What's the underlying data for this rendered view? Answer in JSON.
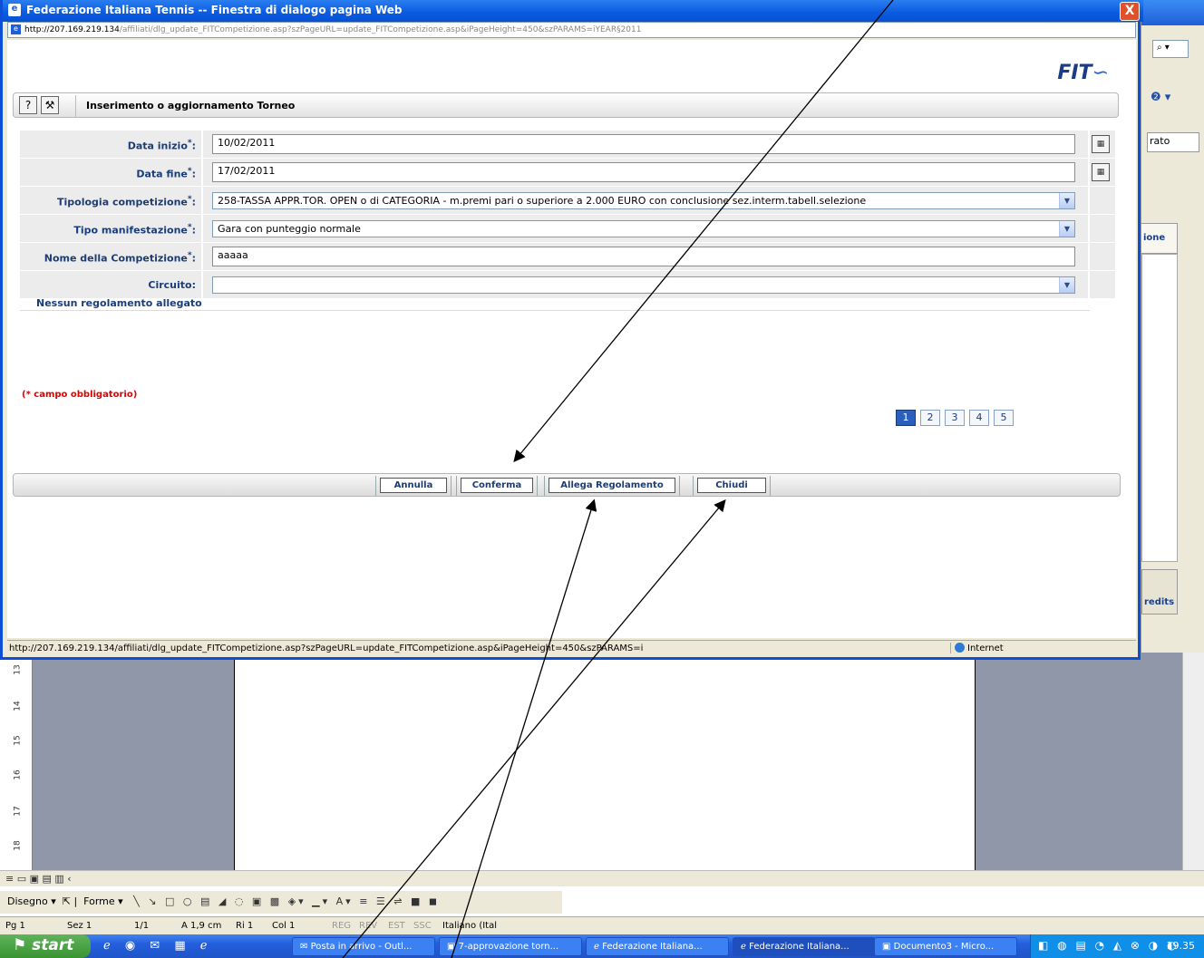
{
  "dialog": {
    "title": "Federazione Italiana Tennis -- Finestra di dialogo pagina Web",
    "close_label": "X",
    "url_host": "http://207.169.219.134",
    "url_path": "/affiliati/dlg_update_FITCompetizione.asp?szPageURL=update_FITCompetizione.asp&iPageHeight=450&szPARAMS=iYEAR§2011",
    "logo_text": "FIT",
    "status_url": "http://207.169.219.134/affiliati/dlg_update_FITCompetizione.asp?szPageURL=update_FITCompetizione.asp&iPageHeight=450&szPARAMS=i",
    "zone": "Internet"
  },
  "header": {
    "help_icon": "?",
    "tool_icon": "⚒",
    "title": "Inserimento o aggiornamento Torneo"
  },
  "form": {
    "data_inizio_label": "Data inizio",
    "data_inizio_value": "10/02/2011",
    "data_fine_label": "Data fine",
    "data_fine_value": "17/02/2011",
    "tipologia_label": "Tipologia competizione",
    "tipologia_value": "258-TASSA APPR.TOR. OPEN o di CATEGORIA - m.premi pari o superiore a 2.000 EURO con conclusione sez.interm.tabell.selezione",
    "tipo_label": "Tipo manifestazione",
    "tipo_value": "Gara con punteggio normale",
    "nome_label": "Nome della Competizione",
    "nome_value": "aaaaa",
    "circuito_label": "Circuito",
    "circuito_value": "",
    "required_mark": "*",
    "colon": ":",
    "no_regolamento": "Nessun regolamento allegato",
    "required_note": "(* campo obbligatorio)"
  },
  "pager": [
    "1",
    "2",
    "3",
    "4",
    "5"
  ],
  "buttons": {
    "annulla": "Annulla",
    "conferma": "Conferma",
    "allega": "Allega Regolamento",
    "chiudi": "Chiudi"
  },
  "background": {
    "right_text": "rato",
    "right_tab": "ione",
    "right_btn": "redits",
    "ruler_marks": [
      "13",
      "14",
      "15",
      "16",
      "17",
      "18"
    ],
    "draw_toolbar": {
      "disegno": "Disegno ▾",
      "forme": "Forme ▾"
    },
    "status": {
      "pg": "Pg 1",
      "sez": "Sez 1",
      "pages": "1/1",
      "at": "A 1,9 cm",
      "ri": "Ri 1",
      "col": "Col 1",
      "reg": "REG",
      "rev": "REV",
      "est": "EST",
      "ssc": "SSC",
      "lang": "Italiano (Ital"
    }
  },
  "taskbar": {
    "start": "start",
    "tasks": [
      "Posta in arrivo - Outl...",
      "7-approvazione torn...",
      "Federazione Italiana...",
      "Federazione Italiana...",
      "Documento3 - Micro..."
    ],
    "clock": "19.35"
  }
}
